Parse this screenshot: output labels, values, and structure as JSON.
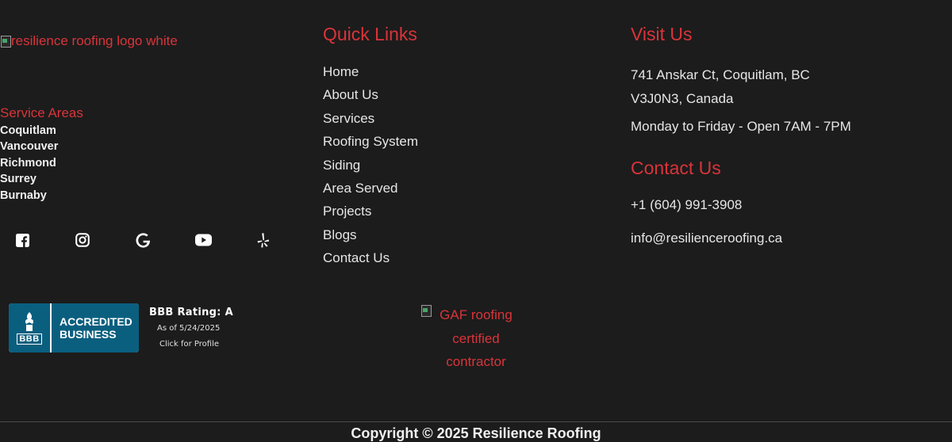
{
  "brand": {
    "logo_alt": "resilience roofing logo white"
  },
  "service_areas": {
    "title": "Service Areas",
    "items": [
      "Coquitlam",
      "Vancouver",
      "Richmond",
      "Surrey",
      "Burnaby"
    ]
  },
  "socials": [
    "facebook-icon",
    "instagram-icon",
    "google-icon",
    "youtube-icon",
    "yelp-icon"
  ],
  "bbb": {
    "badge_line1": "ACCREDITED",
    "badge_line2": "BUSINESS",
    "badge_logo": "BBB",
    "rating": "BBB Rating: A",
    "as_of": "As of 5/24/2025",
    "click": "Click for Profile"
  },
  "quick_links": {
    "title": "Quick Links",
    "items": [
      "Home",
      "About Us",
      "Services",
      "Roofing System",
      "Siding",
      "Area Served",
      "Projects",
      "Blogs",
      "Contact Us"
    ]
  },
  "gaf": {
    "line1": "GAF roofing",
    "line2": "certified",
    "line3": "contractor"
  },
  "visit": {
    "title": "Visit Us",
    "address_line1": "741 Anskar Ct, Coquitlam, BC",
    "address_line2": "V3J0N3, Canada",
    "hours": "Monday to Friday - Open 7AM - 7PM"
  },
  "contact": {
    "title": "Contact Us",
    "phone": "+1 (604) 991-3908",
    "email": "info@resilienceroofing.ca"
  },
  "footer": {
    "copyright": "Copyright © 2025 Resilience Roofing"
  },
  "colors": {
    "background": "#1c1c1c",
    "accent": "#d9343a",
    "text": "#e6e6e6",
    "bbb_blue": "#0a5f7f"
  }
}
